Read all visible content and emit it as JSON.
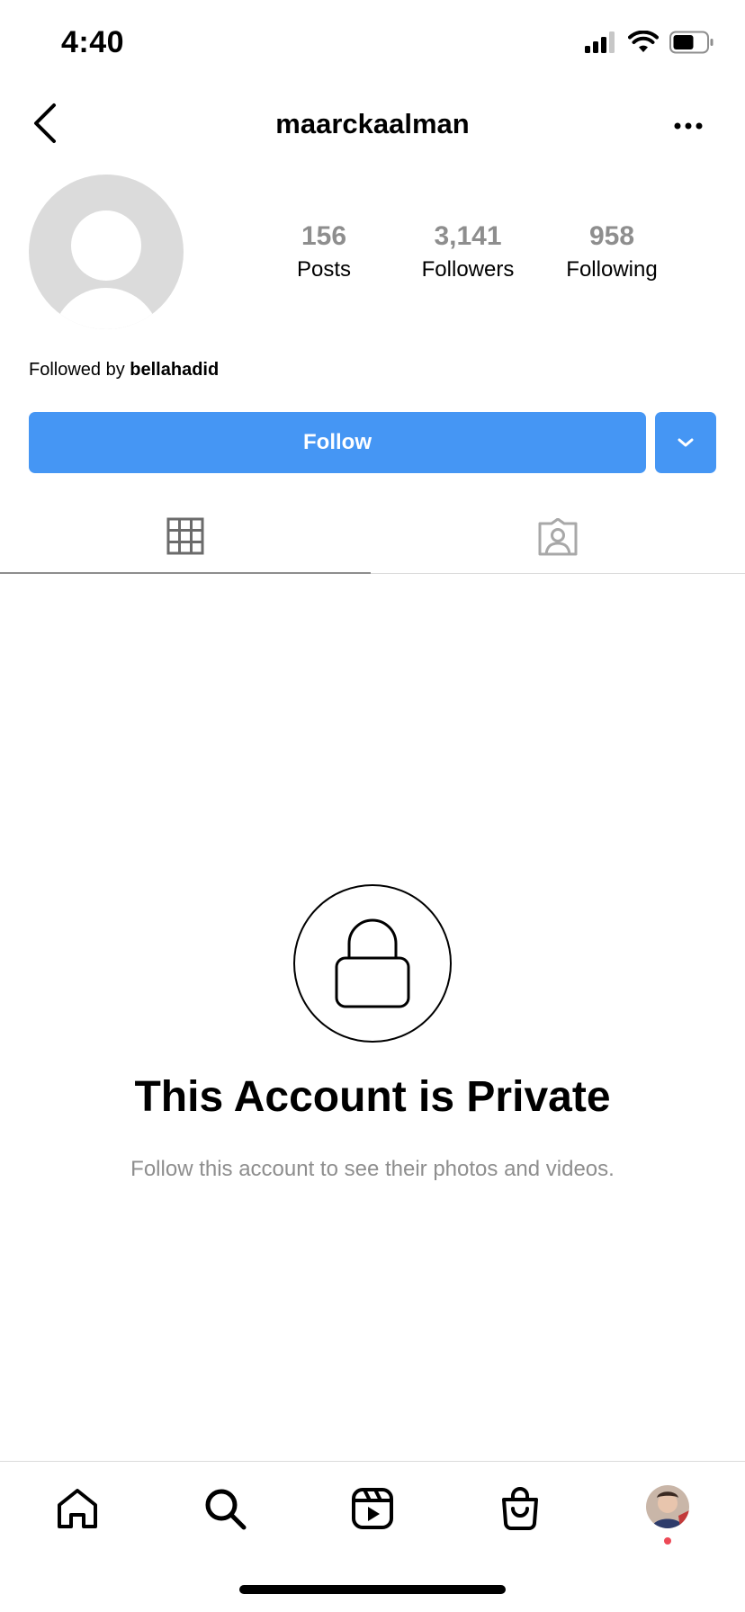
{
  "status_bar": {
    "time": "4:40"
  },
  "header": {
    "username": "maarckaalman"
  },
  "profile": {
    "stats": [
      {
        "value": "156",
        "label": "Posts"
      },
      {
        "value": "3,141",
        "label": "Followers"
      },
      {
        "value": "958",
        "label": "Following"
      }
    ],
    "followed_by_prefix": "Followed by ",
    "followed_by_user": "bellahadid"
  },
  "actions": {
    "follow_label": "Follow"
  },
  "private_notice": {
    "title": "This Account is Private",
    "subtitle": "Follow this account to see their photos and videos."
  },
  "colors": {
    "accent": "#4596f4",
    "muted": "#8e8e8e",
    "notification_dot": "#ed4956"
  },
  "icons": {
    "back": "chevron-left-icon",
    "more": "more-horizontal-icon",
    "posts_tab": "grid-icon",
    "tagged_tab": "tagged-person-icon",
    "lock": "lock-icon",
    "nav": [
      "home-icon",
      "search-icon",
      "reels-icon",
      "shop-icon",
      "profile-avatar"
    ]
  }
}
